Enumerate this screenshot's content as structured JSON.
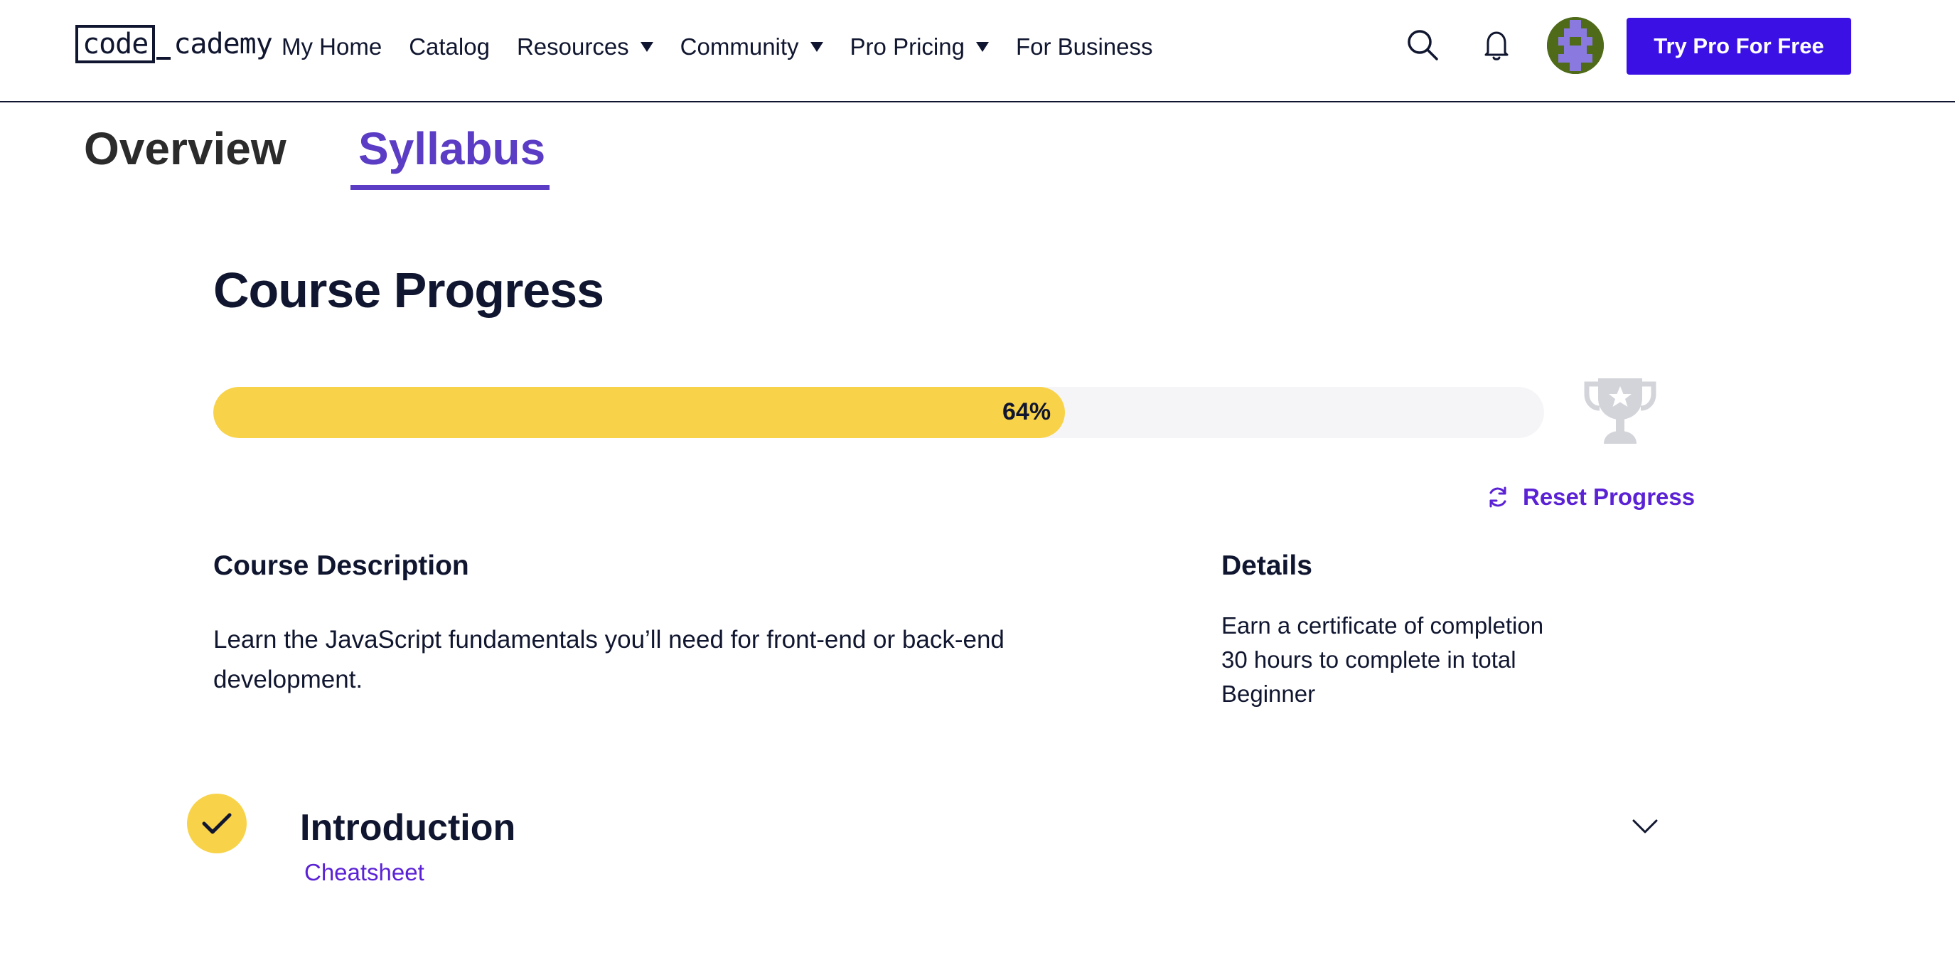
{
  "header": {
    "logo_code": "code",
    "logo_rest": "cademy",
    "nav": [
      {
        "label": "My Home",
        "dropdown": false
      },
      {
        "label": "Catalog",
        "dropdown": false
      },
      {
        "label": "Resources",
        "dropdown": true
      },
      {
        "label": "Community",
        "dropdown": true
      },
      {
        "label": "Pro Pricing",
        "dropdown": true
      },
      {
        "label": "For Business",
        "dropdown": false
      }
    ],
    "icons": [
      "search-icon",
      "bell-icon"
    ],
    "cta_label": "Try Pro For Free",
    "cta_color": "#3a10e5"
  },
  "tabs": [
    {
      "label": "Overview",
      "active": false
    },
    {
      "label": "Syllabus",
      "active": true
    }
  ],
  "progress": {
    "title": "Course Progress",
    "percent": 64,
    "percent_label": "64%",
    "fill_color": "#f8d349",
    "reset_label": "Reset Progress",
    "trophy_icon": "trophy-icon"
  },
  "description": {
    "heading": "Course Description",
    "text": "Learn the JavaScript fundamentals you’ll need for front-end or back-end development."
  },
  "details": {
    "heading": "Details",
    "items": [
      "Earn a certificate of completion",
      "30 hours to complete in total",
      "Beginner"
    ]
  },
  "module": {
    "title": "Introduction",
    "completed": true,
    "link_label": "Cheatsheet",
    "expand_icon": "chevron-down-icon"
  },
  "colors": {
    "accent": "#5b22d5",
    "text": "#10162f",
    "yellow": "#f8d349"
  }
}
